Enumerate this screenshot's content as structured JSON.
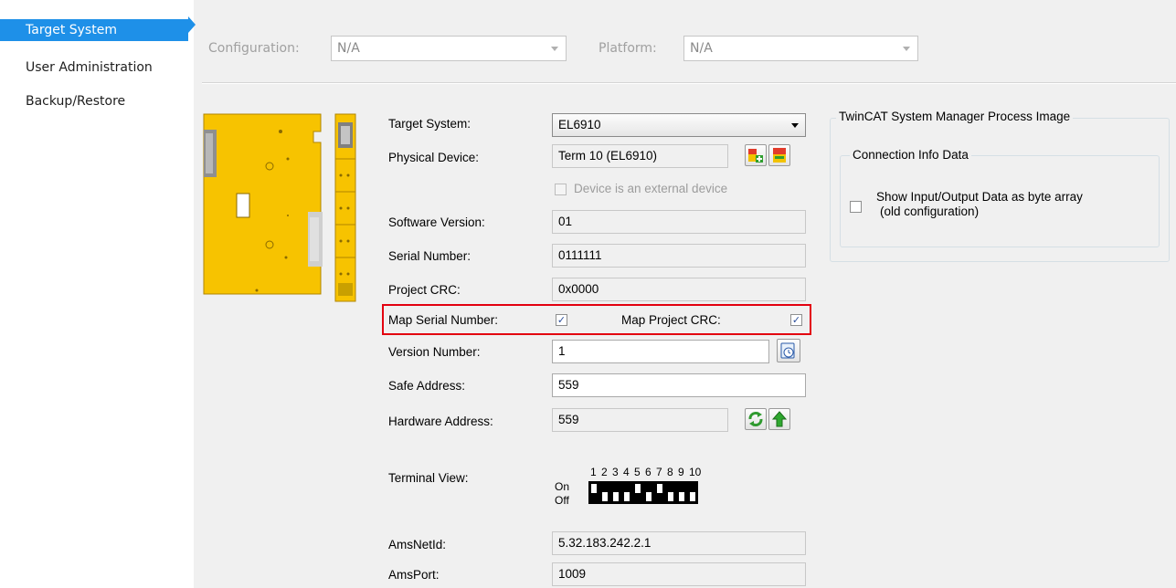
{
  "nav": {
    "items": [
      "Target System",
      "User Administration",
      "Backup/Restore"
    ],
    "active_index": 0
  },
  "top": {
    "configuration_label": "Configuration:",
    "configuration_value": "N/A",
    "platform_label": "Platform:",
    "platform_value": "N/A"
  },
  "form": {
    "target_system_label": "Target System:",
    "target_system_value": "EL6910",
    "physical_device_label": "Physical Device:",
    "physical_device_value": "Term 10 (EL6910)",
    "external_device_label": "Device is an external device",
    "external_device_checked": false,
    "software_version_label": "Software Version:",
    "software_version_value": "01",
    "serial_number_label": "Serial Number:",
    "serial_number_value": "0111111",
    "project_crc_label": "Project CRC:",
    "project_crc_value": "0x0000",
    "map_serial_label": "Map Serial Number:",
    "map_serial_checked": true,
    "map_crc_label": "Map Project CRC:",
    "map_crc_checked": true,
    "version_number_label": "Version Number:",
    "version_number_value": "1",
    "safe_address_label": "Safe Address:",
    "safe_address_value": "559",
    "hardware_address_label": "Hardware Address:",
    "hardware_address_value": "559",
    "terminal_view_label": "Terminal View:",
    "dip_on_label": "On",
    "dip_off_label": "Off",
    "dip_numbers": [
      "1",
      "2",
      "3",
      "4",
      "5",
      "6",
      "7",
      "8",
      "9",
      "10"
    ],
    "amsnetid_label": "AmsNetId:",
    "amsnetid_value": "5.32.183.242.2.1",
    "amsport_label": "AmsPort:",
    "amsport_value": "1009"
  },
  "process_image": {
    "title": "TwinCAT System Manager Process Image",
    "group_title": "Connection Info Data",
    "byte_array_label_line1": "Show Input/Output Data as byte array",
    "byte_array_label_line2": "(old configuration)",
    "byte_array_checked": false
  },
  "colors": {
    "nav_active": "#1e90e8",
    "highlight_border": "#e3000f",
    "terminal_yellow": "#f7c300"
  },
  "icons": {
    "physical_device_buttons": [
      "add-device-icon",
      "remove-device-icon"
    ],
    "version_button": "calculator-icon",
    "hardware_buttons": [
      "refresh-icon",
      "upload-arrow-icon"
    ]
  }
}
